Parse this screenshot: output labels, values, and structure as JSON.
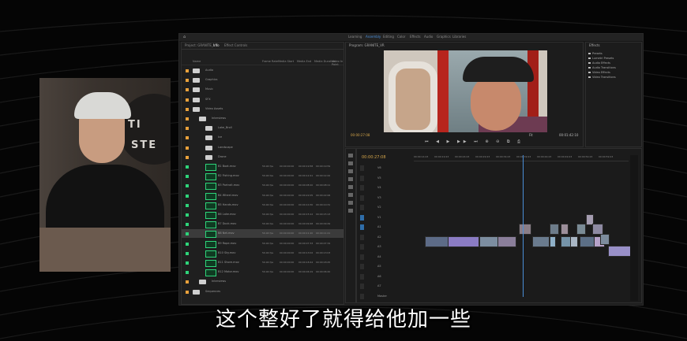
{
  "topbar": {
    "workspaces": [
      "Learning",
      "Assembly",
      "Editing",
      "Color",
      "Effects",
      "Audio",
      "Graphics",
      "Libraries"
    ],
    "active_index": 1
  },
  "project_panel": {
    "tabs": [
      "Project: GRANITE_VR",
      "Info",
      "Effect Controls"
    ],
    "columns": [
      "Name",
      "Frame Rate",
      "Media Start",
      "Media End",
      "Media Duration",
      "Video In Point"
    ],
    "rows": [
      {
        "type": "folder",
        "label": "Audio",
        "indent": 0
      },
      {
        "type": "folder",
        "label": "Graphics",
        "indent": 0
      },
      {
        "type": "folder",
        "label": "Music",
        "indent": 0
      },
      {
        "type": "folder",
        "label": "SFX",
        "indent": 0
      },
      {
        "type": "folder",
        "label": "Video Assets",
        "indent": 0
      },
      {
        "type": "folder",
        "label": "Interviews",
        "indent": 1
      },
      {
        "type": "folder",
        "label": "Lake_Broll",
        "indent": 2
      },
      {
        "type": "folder",
        "label": "Ice",
        "indent": 2
      },
      {
        "type": "folder",
        "label": "Landscape",
        "indent": 2
      },
      {
        "type": "folder",
        "label": "Drone",
        "indent": 2
      },
      {
        "type": "clip",
        "label": "B1 Boat.mov",
        "rate": "59.94 fps",
        "start": "00:00:00:00",
        "end": "00:00:19:58",
        "dur": "00:00:19:59"
      },
      {
        "type": "clip",
        "label": "B2 Fishing.mov",
        "rate": "59.94 fps",
        "start": "00:00:00:00",
        "end": "00:00:12:41",
        "dur": "00:00:12:42"
      },
      {
        "type": "clip",
        "label": "B3 Portrait.mov",
        "rate": "59.94 fps",
        "start": "00:00:00:00",
        "end": "00:00:08:10",
        "dur": "00:00:08:11"
      },
      {
        "type": "clip",
        "label": "B4 Wheel.mov",
        "rate": "59.94 fps",
        "start": "00:00:00:00",
        "end": "00:00:22:05",
        "dur": "00:00:22:06"
      },
      {
        "type": "clip",
        "label": "B5 Hands.mov",
        "rate": "59.94 fps",
        "start": "00:00:00:00",
        "end": "00:00:10:30",
        "dur": "00:00:10:31"
      },
      {
        "type": "clip",
        "label": "B6 Lake.mov",
        "rate": "59.94 fps",
        "start": "00:00:00:00",
        "end": "00:00:15:12",
        "dur": "00:00:15:13"
      },
      {
        "type": "clip",
        "label": "B7 Dock.mov",
        "rate": "59.94 fps",
        "start": "00:00:00:00",
        "end": "00:00:09:48",
        "dur": "00:00:09:49"
      },
      {
        "type": "clip",
        "label": "B8 Net.mov",
        "rate": "59.94 fps",
        "start": "00:00:00:00",
        "end": "00:00:11:20",
        "dur": "00:00:11:21",
        "selected": true
      },
      {
        "type": "clip",
        "label": "B9 Rope.mov",
        "rate": "59.94 fps",
        "start": "00:00:00:00",
        "end": "00:00:07:33",
        "dur": "00:00:07:34"
      },
      {
        "type": "clip",
        "label": "B10 Sky.mov",
        "rate": "59.94 fps",
        "start": "00:00:00:00",
        "end": "00:00:13:02",
        "dur": "00:00:13:03"
      },
      {
        "type": "clip",
        "label": "B11 Shore.mov",
        "rate": "59.94 fps",
        "start": "00:00:00:00",
        "end": "00:00:18:44",
        "dur": "00:00:18:45"
      },
      {
        "type": "clip",
        "label": "B12 Motor.mov",
        "rate": "59.94 fps",
        "start": "00:00:00:00",
        "end": "00:00:06:19",
        "dur": "00:00:06:20"
      },
      {
        "type": "folder",
        "label": "Interviews",
        "indent": 1
      },
      {
        "type": "folder",
        "label": "Sequences",
        "indent": 0
      }
    ]
  },
  "program_monitor": {
    "title": "Program: GRANITE_VR",
    "timecode": "00:00:27:08",
    "fit": "Fit",
    "duration": "00:01:42:10",
    "controls": "⏮ ◀ ▶ ▶▶ ⏭ ⊕ ⊖ ⧉ ⎙"
  },
  "effects_panel": {
    "title": "Effects",
    "items": [
      "Presets",
      "Lumetri Presets",
      "Audio Effects",
      "Audio Transitions",
      "Video Effects",
      "Video Transitions"
    ]
  },
  "timeline": {
    "timecode": "00:00:27:08",
    "ruler": [
      "00:00:14:23",
      "00:00:19:23",
      "00:00:24:23",
      "00:00:29:23",
      "00:00:34:23",
      "00:00:39:23",
      "00:00:44:23",
      "00:00:49:23",
      "00:00:54:23",
      "00:00:59:23"
    ],
    "tracks": [
      "V6",
      "V5",
      "V4",
      "V3",
      "V2",
      "V1",
      "A1",
      "A2",
      "A3",
      "A4",
      "A5",
      "A6",
      "A7",
      "Master"
    ]
  },
  "subtitle": "这个整好了就得给他加一些",
  "webcam_sign": [
    "TI",
    "STE"
  ]
}
